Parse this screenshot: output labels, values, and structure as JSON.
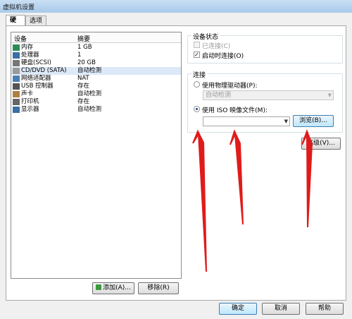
{
  "window": {
    "title": "虚拟机设置"
  },
  "tabs": [
    {
      "label": "硬件",
      "active": true
    },
    {
      "label": "选项",
      "active": false
    }
  ],
  "devices": {
    "col_device": "设备",
    "col_summary": "摘要",
    "rows": [
      {
        "name": "内存",
        "summary": "1 GB",
        "icon": "memory-icon",
        "color": "#2e8b57"
      },
      {
        "name": "处理器",
        "summary": "1",
        "icon": "processor-icon",
        "color": "#3a6ea5"
      },
      {
        "name": "硬盘(SCSI)",
        "summary": "20 GB",
        "icon": "hard-disk-icon",
        "color": "#777777"
      },
      {
        "name": "CD/DVD (SATA)",
        "summary": "自动检测",
        "icon": "cd-dvd-icon",
        "color": "#9a9a9a",
        "selected": true
      },
      {
        "name": "网络适配器",
        "summary": "NAT",
        "icon": "network-adapter-icon",
        "color": "#4a7fb5"
      },
      {
        "name": "USB 控制器",
        "summary": "存在",
        "icon": "usb-controller-icon",
        "color": "#555555"
      },
      {
        "name": "声卡",
        "summary": "自动检测",
        "icon": "sound-card-icon",
        "color": "#b08040"
      },
      {
        "name": "打印机",
        "summary": "存在",
        "icon": "printer-icon",
        "color": "#666666"
      },
      {
        "name": "显示器",
        "summary": "自动检测",
        "icon": "display-icon",
        "color": "#3a6ea5"
      }
    ],
    "add_label": "添加(A)...",
    "remove_label": "移除(R)"
  },
  "device_status": {
    "legend": "设备状态",
    "connected_label": "已连接(C)",
    "connected": false,
    "connect_on_power_label": "启动时连接(O)",
    "connect_on_power": true
  },
  "connection": {
    "legend": "连接",
    "physical_label": "使用物理驱动器(P):",
    "physical_value": "自动检测",
    "iso_label": "使用 ISO 映像文件(M):",
    "iso_selected": true,
    "iso_value": "",
    "browse_label": "浏览(B)...",
    "advanced_label": "高级(V)..."
  },
  "footer": {
    "ok_label": "确定",
    "cancel_label": "取消",
    "help_label": "帮助"
  },
  "colors": {
    "accent": "#3c7fb1",
    "arrows": "#e01b1b"
  }
}
